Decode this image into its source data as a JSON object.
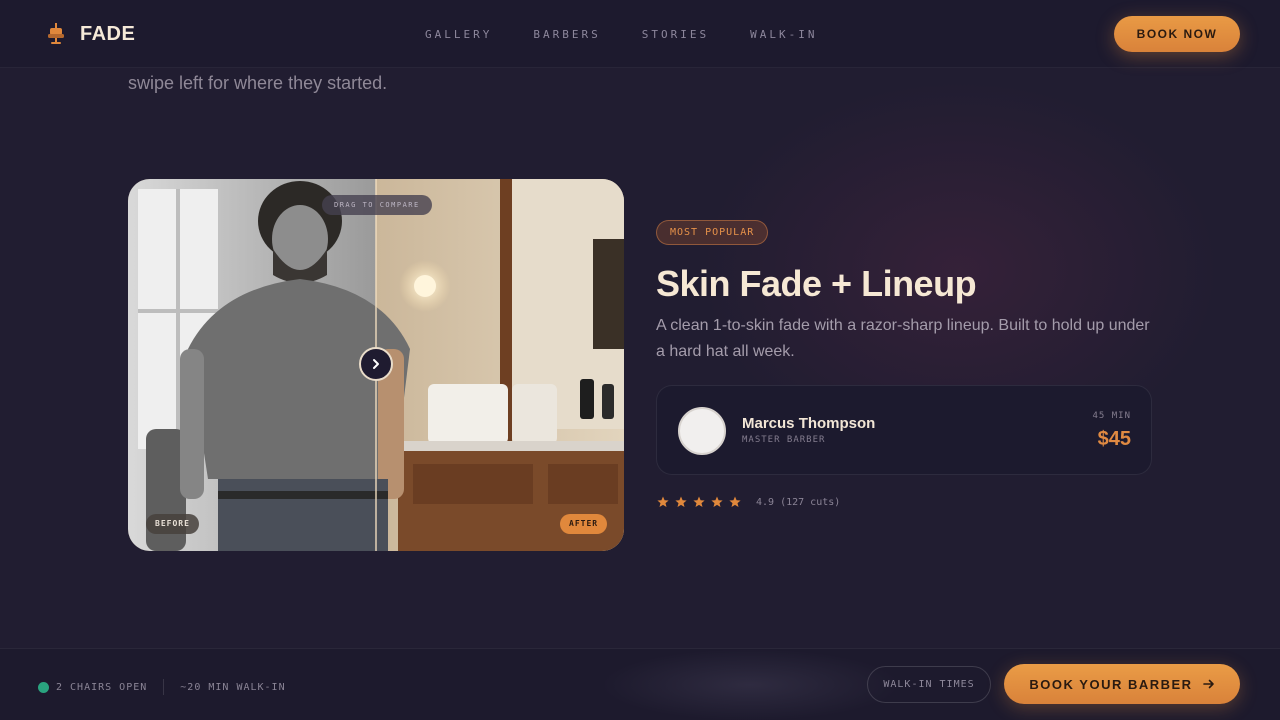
{
  "brand": {
    "name": "FADE",
    "logo_icon": "barber-chair-icon"
  },
  "nav": {
    "items": [
      "GALLERY",
      "BARBERS",
      "STORIES",
      "WALK-IN"
    ]
  },
  "header": {
    "book_now_label": "BOOK NOW"
  },
  "intro": {
    "tail_text": "swipe left for where they started."
  },
  "compare": {
    "drag_hint": "DRAG TO COMPARE",
    "before_label": "BEFORE",
    "after_label": "AFTER",
    "handle_icon": "chevron-right-icon",
    "slider_position_percent": 50
  },
  "service": {
    "badge": "MOST POPULAR",
    "title": "Skin Fade + Lineup",
    "description": "A clean 1-to-skin fade with a razor-sharp lineup. Built to hold up under a hard hat all week.",
    "barber": {
      "name": "Marcus Thompson",
      "role": "MASTER BARBER"
    },
    "duration": "45 MIN",
    "price": "$45",
    "rating": {
      "stars": 5,
      "text": "4.9 (127 cuts)"
    }
  },
  "bottom_bar": {
    "chairs_status": "2 CHAIRS OPEN",
    "walkin_estimate": "~20 MIN WALK-IN",
    "walkin_times_label": "WALK-IN TIMES",
    "cta_label": "BOOK YOUR BARBER",
    "cta_icon": "arrow-right-icon"
  },
  "colors": {
    "background": "#211d31",
    "accent": "#e08a42",
    "status_open": "#2aa37f"
  }
}
